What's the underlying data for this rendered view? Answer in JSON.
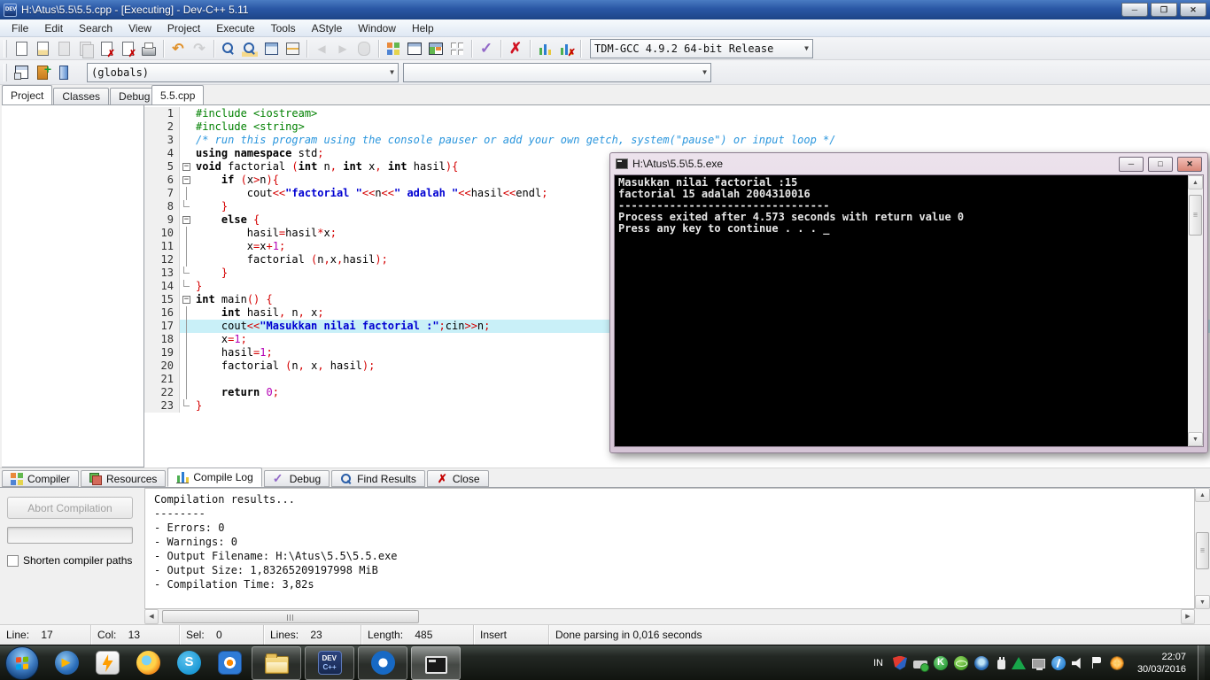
{
  "window": {
    "title": "H:\\Atus\\5.5\\5.5.cpp - [Executing] - Dev-C++ 5.11"
  },
  "window_controls": {
    "minimize": "─",
    "restore": "❐",
    "close": "✕"
  },
  "menu": {
    "items": [
      "File",
      "Edit",
      "Search",
      "View",
      "Project",
      "Execute",
      "Tools",
      "AStyle",
      "Window",
      "Help"
    ]
  },
  "toolbar_main": {
    "groups": [
      [
        "new-file-icon",
        "open-file-icon",
        "save-icon",
        "save-all-icon",
        "close-file-icon",
        "close-all-icon",
        "print-icon"
      ],
      [
        "undo-icon",
        "redo-icon"
      ],
      [
        "find-icon",
        "replace-icon",
        "goto-function-icon",
        "goto-line-icon"
      ],
      [
        "back-icon",
        "forward-icon",
        "breakpoint-icon"
      ],
      [
        "compile-icon",
        "run-icon",
        "compile-run-icon",
        "rebuild-icon"
      ],
      [
        "syntax-check-icon"
      ],
      [
        "abort-icon"
      ],
      [
        "profile-icon",
        "delete-profile-icon"
      ]
    ],
    "disabled": [
      "save-icon",
      "save-all-icon",
      "redo-icon",
      "back-icon",
      "forward-icon",
      "breakpoint-icon"
    ],
    "compiler_select": "TDM-GCC 4.9.2 64-bit Release"
  },
  "toolbar_specials": {
    "icons": [
      "new-unit-icon",
      "add-file-icon",
      "remove-file-icon"
    ],
    "globals_select": "(globals)",
    "members_select": ""
  },
  "sidebar": {
    "tabs": [
      "Project",
      "Classes",
      "Debug"
    ],
    "active": 0
  },
  "editor": {
    "tab": "5.5.cpp",
    "active_line": 17,
    "lines": [
      {
        "num": 1,
        "fold": "",
        "segs": [
          {
            "c": "g",
            "t": "#include <iostream>"
          }
        ]
      },
      {
        "num": 2,
        "fold": "",
        "segs": [
          {
            "c": "g",
            "t": "#include <string>"
          }
        ]
      },
      {
        "num": 3,
        "fold": "",
        "segs": [
          {
            "c": "cm",
            "t": "/* run this program using the console pauser or add your own getch, system(\"pause\") or input loop */"
          }
        ]
      },
      {
        "num": 4,
        "fold": "",
        "segs": [
          {
            "c": "k",
            "t": "using"
          },
          {
            "c": "p",
            "t": " "
          },
          {
            "c": "k",
            "t": "namespace"
          },
          {
            "c": "p",
            "t": " std"
          },
          {
            "c": "r",
            "t": ";"
          }
        ]
      },
      {
        "num": 5,
        "fold": "open",
        "segs": [
          {
            "c": "k",
            "t": "void"
          },
          {
            "c": "p",
            "t": " factorial "
          },
          {
            "c": "r",
            "t": "("
          },
          {
            "c": "k",
            "t": "int"
          },
          {
            "c": "p",
            "t": " n"
          },
          {
            "c": "r",
            "t": ","
          },
          {
            "c": "p",
            "t": " "
          },
          {
            "c": "k",
            "t": "int"
          },
          {
            "c": "p",
            "t": " x"
          },
          {
            "c": "r",
            "t": ","
          },
          {
            "c": "p",
            "t": " "
          },
          {
            "c": "k",
            "t": "int"
          },
          {
            "c": "p",
            "t": " hasil"
          },
          {
            "c": "r",
            "t": "){"
          }
        ]
      },
      {
        "num": 6,
        "fold": "open",
        "segs": [
          {
            "c": "p",
            "t": "    "
          },
          {
            "c": "k",
            "t": "if"
          },
          {
            "c": "p",
            "t": " "
          },
          {
            "c": "r",
            "t": "("
          },
          {
            "c": "p",
            "t": "x"
          },
          {
            "c": "r",
            "t": ">"
          },
          {
            "c": "p",
            "t": "n"
          },
          {
            "c": "r",
            "t": "){"
          }
        ]
      },
      {
        "num": 7,
        "fold": "line",
        "segs": [
          {
            "c": "p",
            "t": "        cout"
          },
          {
            "c": "r",
            "t": "<<"
          },
          {
            "c": "s",
            "t": "\"factorial \""
          },
          {
            "c": "r",
            "t": "<<"
          },
          {
            "c": "p",
            "t": "n"
          },
          {
            "c": "r",
            "t": "<<"
          },
          {
            "c": "s",
            "t": "\" adalah \""
          },
          {
            "c": "r",
            "t": "<<"
          },
          {
            "c": "p",
            "t": "hasil"
          },
          {
            "c": "r",
            "t": "<<"
          },
          {
            "c": "p",
            "t": "endl"
          },
          {
            "c": "r",
            "t": ";"
          }
        ]
      },
      {
        "num": 8,
        "fold": "end",
        "segs": [
          {
            "c": "p",
            "t": "    "
          },
          {
            "c": "r",
            "t": "}"
          }
        ]
      },
      {
        "num": 9,
        "fold": "open",
        "segs": [
          {
            "c": "p",
            "t": "    "
          },
          {
            "c": "k",
            "t": "else"
          },
          {
            "c": "p",
            "t": " "
          },
          {
            "c": "r",
            "t": "{"
          }
        ]
      },
      {
        "num": 10,
        "fold": "line",
        "segs": [
          {
            "c": "p",
            "t": "        hasil"
          },
          {
            "c": "r",
            "t": "="
          },
          {
            "c": "p",
            "t": "hasil"
          },
          {
            "c": "r",
            "t": "*"
          },
          {
            "c": "p",
            "t": "x"
          },
          {
            "c": "r",
            "t": ";"
          }
        ]
      },
      {
        "num": 11,
        "fold": "line",
        "segs": [
          {
            "c": "p",
            "t": "        x"
          },
          {
            "c": "r",
            "t": "="
          },
          {
            "c": "p",
            "t": "x"
          },
          {
            "c": "r",
            "t": "+"
          },
          {
            "c": "n",
            "t": "1"
          },
          {
            "c": "r",
            "t": ";"
          }
        ]
      },
      {
        "num": 12,
        "fold": "line",
        "segs": [
          {
            "c": "p",
            "t": "        factorial "
          },
          {
            "c": "r",
            "t": "("
          },
          {
            "c": "p",
            "t": "n"
          },
          {
            "c": "r",
            "t": ","
          },
          {
            "c": "p",
            "t": "x"
          },
          {
            "c": "r",
            "t": ","
          },
          {
            "c": "p",
            "t": "hasil"
          },
          {
            "c": "r",
            "t": ");"
          }
        ]
      },
      {
        "num": 13,
        "fold": "end",
        "segs": [
          {
            "c": "p",
            "t": "    "
          },
          {
            "c": "r",
            "t": "}"
          }
        ]
      },
      {
        "num": 14,
        "fold": "end",
        "segs": [
          {
            "c": "r",
            "t": "}"
          }
        ]
      },
      {
        "num": 15,
        "fold": "open",
        "segs": [
          {
            "c": "k",
            "t": "int"
          },
          {
            "c": "p",
            "t": " main"
          },
          {
            "c": "r",
            "t": "()"
          },
          {
            "c": "p",
            "t": " "
          },
          {
            "c": "r",
            "t": "{"
          }
        ]
      },
      {
        "num": 16,
        "fold": "line",
        "segs": [
          {
            "c": "p",
            "t": "    "
          },
          {
            "c": "k",
            "t": "int"
          },
          {
            "c": "p",
            "t": " hasil"
          },
          {
            "c": "r",
            "t": ","
          },
          {
            "c": "p",
            "t": " n"
          },
          {
            "c": "r",
            "t": ","
          },
          {
            "c": "p",
            "t": " x"
          },
          {
            "c": "r",
            "t": ";"
          }
        ]
      },
      {
        "num": 17,
        "fold": "line",
        "segs": [
          {
            "c": "p",
            "t": "    cout"
          },
          {
            "c": "r",
            "t": "<<"
          },
          {
            "c": "s",
            "t": "\"Masukkan nilai factorial :\""
          },
          {
            "c": "r",
            "t": ";"
          },
          {
            "c": "p",
            "t": "cin"
          },
          {
            "c": "r",
            "t": ">>"
          },
          {
            "c": "p",
            "t": "n"
          },
          {
            "c": "r",
            "t": ";"
          }
        ]
      },
      {
        "num": 18,
        "fold": "line",
        "segs": [
          {
            "c": "p",
            "t": "    x"
          },
          {
            "c": "r",
            "t": "="
          },
          {
            "c": "n",
            "t": "1"
          },
          {
            "c": "r",
            "t": ";"
          }
        ]
      },
      {
        "num": 19,
        "fold": "line",
        "segs": [
          {
            "c": "p",
            "t": "    hasil"
          },
          {
            "c": "r",
            "t": "="
          },
          {
            "c": "n",
            "t": "1"
          },
          {
            "c": "r",
            "t": ";"
          }
        ]
      },
      {
        "num": 20,
        "fold": "line",
        "segs": [
          {
            "c": "p",
            "t": "    factorial "
          },
          {
            "c": "r",
            "t": "("
          },
          {
            "c": "p",
            "t": "n"
          },
          {
            "c": "r",
            "t": ","
          },
          {
            "c": "p",
            "t": " x"
          },
          {
            "c": "r",
            "t": ","
          },
          {
            "c": "p",
            "t": " hasil"
          },
          {
            "c": "r",
            "t": ");"
          }
        ]
      },
      {
        "num": 21,
        "fold": "line",
        "segs": []
      },
      {
        "num": 22,
        "fold": "line",
        "segs": [
          {
            "c": "p",
            "t": "    "
          },
          {
            "c": "k",
            "t": "return"
          },
          {
            "c": "p",
            "t": " "
          },
          {
            "c": "n",
            "t": "0"
          },
          {
            "c": "r",
            "t": ";"
          }
        ]
      },
      {
        "num": 23,
        "fold": "end",
        "segs": [
          {
            "c": "r",
            "t": "}"
          }
        ]
      }
    ]
  },
  "console": {
    "title": "H:\\Atus\\5.5\\5.5.exe",
    "controls": {
      "minimize": "─",
      "maximize": "□",
      "close": "✕"
    },
    "lines": [
      "Masukkan nilai factorial :15",
      "factorial 15 adalah 2004310016",
      "",
      "---------------------------------",
      "Process exited after 4.573 seconds with return value 0",
      "Press any key to continue . . . _"
    ]
  },
  "bottom_tabs": [
    {
      "label": "Compiler",
      "icon": "bt-squares",
      "active": false
    },
    {
      "label": "Resources",
      "icon": "bt-stack",
      "active": false
    },
    {
      "label": "Compile Log",
      "icon": "bt-chart",
      "active": true
    },
    {
      "label": "Debug",
      "icon": "bt-check",
      "active": false
    },
    {
      "label": "Find Results",
      "icon": "bt-search",
      "active": false
    },
    {
      "label": "Close",
      "icon": "bt-close",
      "active": false
    }
  ],
  "compile_log": {
    "abort_button": "Abort Compilation",
    "checkbox_label": "Shorten compiler paths",
    "lines": [
      "Compilation results...",
      "--------",
      "- Errors: 0",
      "- Warnings: 0",
      "- Output Filename: H:\\Atus\\5.5\\5.5.exe",
      "- Output Size: 1,83265209197998 MiB",
      "- Compilation Time: 3,82s"
    ]
  },
  "statusbar": {
    "segments": [
      "Line:    17",
      "Col:    13",
      "Sel:    0",
      "Lines:    23",
      "Length:    485",
      "Insert",
      "Done parsing in 0,016 seconds"
    ]
  },
  "taskbar": {
    "language": "IN",
    "apps": [
      {
        "name": "wmp",
        "open": false,
        "active": false
      },
      {
        "name": "winamp",
        "open": false,
        "active": false
      },
      {
        "name": "firefox",
        "open": false,
        "active": false
      },
      {
        "name": "skype",
        "open": false,
        "active": false
      },
      {
        "name": "picpick",
        "open": false,
        "active": false
      },
      {
        "name": "explorer",
        "open": true,
        "active": false
      },
      {
        "name": "devcpp",
        "open": true,
        "active": false
      },
      {
        "name": "viewer",
        "open": true,
        "active": false
      },
      {
        "name": "console",
        "open": true,
        "active": true
      }
    ],
    "tray_icons": [
      "shield",
      "usb",
      "kmp",
      "idm",
      "blue",
      "plug",
      "smadav",
      "monitor",
      "bolt",
      "speaker",
      "flag",
      "spark"
    ],
    "clock": {
      "time": "22:07",
      "date": "30/03/2016"
    }
  }
}
